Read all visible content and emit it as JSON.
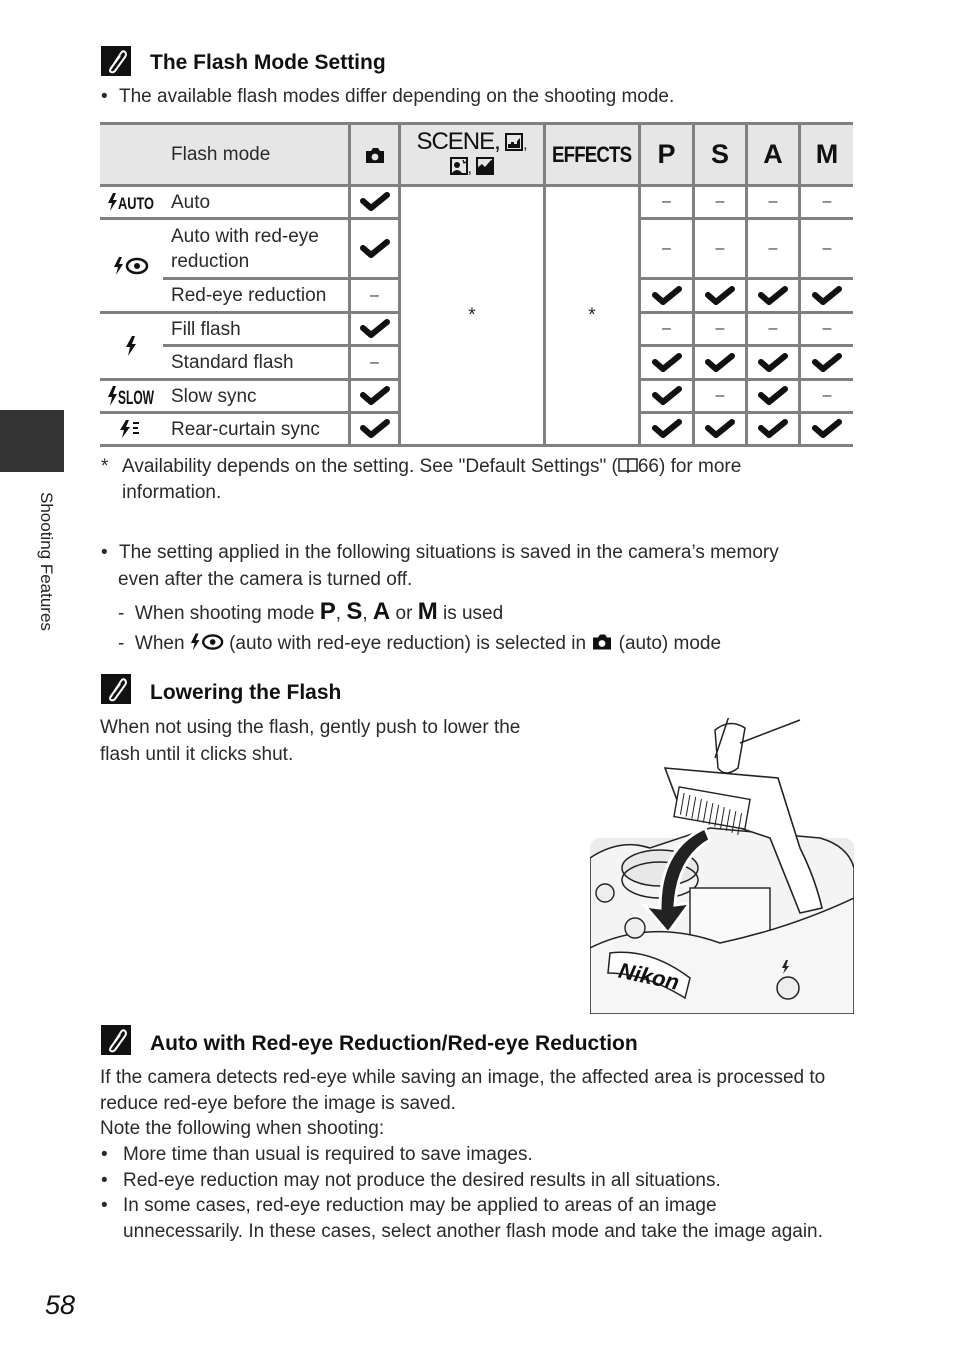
{
  "sidebar": {
    "section_label": "Shooting Features"
  },
  "page_number": "58",
  "section1": {
    "icon": "note-pencil-icon",
    "title": "The Flash Mode Setting",
    "bullet": "The available flash modes differ depending on the shooting mode."
  },
  "flash_table": {
    "header": {
      "flash_mode": "Flash mode",
      "auto_icon": "camera-icon",
      "scene_line1": "SCENE,",
      "scene_line1_icons": [
        "night-landscape-icon"
      ],
      "scene_line2_icons": [
        "night-portrait-icon",
        "landscape-icon"
      ],
      "effects": "EFFECTS",
      "p": "P",
      "s": "S",
      "a": "A",
      "m": "M"
    },
    "rows": [
      {
        "symbol": "$AUTO",
        "symbol_icon": "flash-auto-icon",
        "label": "Auto",
        "auto": "check",
        "p": "–",
        "s": "–",
        "a": "–",
        "m": "–"
      },
      {
        "symbol": "",
        "symbol_icon": "flash-red-eye-icon",
        "label": "Auto with red-eye reduction",
        "auto": "check",
        "p": "–",
        "s": "–",
        "a": "–",
        "m": "–"
      },
      {
        "symbol": "",
        "symbol_icon": "flash-red-eye-icon",
        "label": "Red-eye reduction",
        "auto": "–",
        "p": "check",
        "s": "check",
        "a": "check",
        "m": "check"
      },
      {
        "symbol": "",
        "symbol_icon": "flash-icon",
        "label": "Fill flash",
        "auto": "check",
        "p": "–",
        "s": "–",
        "a": "–",
        "m": "–"
      },
      {
        "symbol": "",
        "symbol_icon": "flash-icon",
        "label": "Standard flash",
        "auto": "–",
        "p": "check",
        "s": "check",
        "a": "check",
        "m": "check"
      },
      {
        "symbol": "$SLOW",
        "symbol_icon": "flash-slow-sync-icon",
        "label": "Slow sync",
        "auto": "check",
        "p": "check",
        "s": "–",
        "a": "check",
        "m": "–"
      },
      {
        "symbol": "",
        "symbol_icon": "flash-rear-curtain-icon",
        "label": "Rear-curtain sync",
        "auto": "check",
        "p": "check",
        "s": "check",
        "a": "check",
        "m": "check"
      }
    ],
    "scene_value": "*",
    "effects_value": "*",
    "footnote_mark": "*",
    "footnote_line1": "Availability depends on the setting. See \"Default Settings\" (",
    "footnote_page": "66) for more",
    "footnote_line2": "information."
  },
  "memory_note": {
    "line1": "The setting applied in the following situations is saved in the camera’s memory",
    "line2": "even after the camera is turned off.",
    "sub1_prefix": "When shooting mode",
    "sub1_modes": [
      "P",
      "S",
      "A",
      "M"
    ],
    "sub1_or": "or",
    "sub1_suffix": "is used",
    "sub2_prefix": "When",
    "sub2_middle": "(auto with red-eye reduction) is selected in",
    "sub2_suffix": "(auto) mode"
  },
  "section2": {
    "icon": "note-pencil-icon",
    "title": "Lowering the Flash",
    "line1": "When not using the flash, gently push to lower the",
    "line2": "flash until it clicks shut.",
    "illustration": "camera-flash-lowering-illustration",
    "brand": "Nikon"
  },
  "section3": {
    "icon": "note-pencil-icon",
    "title": "Auto with Red-eye Reduction/Red-eye Reduction",
    "para_line1": "If the camera detects red-eye while saving an image, the affected area is processed to",
    "para_line2": "reduce red-eye before the image is saved.",
    "para_line3": "Note the following when shooting:",
    "bullets": [
      "More time than usual is required to save images.",
      "Red-eye reduction may not produce the desired results in all situations.",
      "In some cases, red-eye reduction may be applied to areas of an image",
      "unnecessarily. In these cases, select another flash mode and take the image again."
    ]
  }
}
